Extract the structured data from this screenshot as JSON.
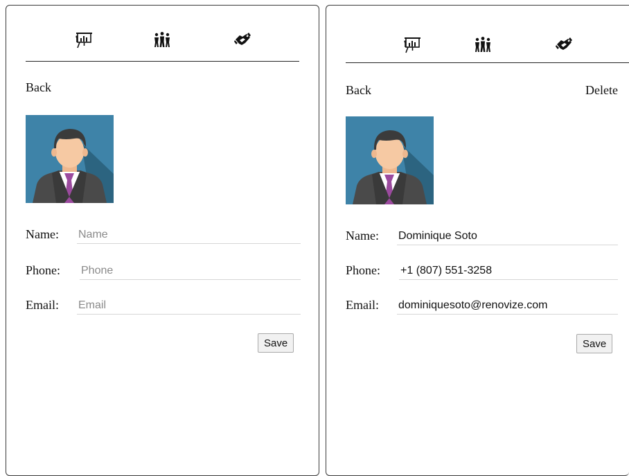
{
  "nav": {
    "icons": [
      "presentation-chart-icon",
      "team-group-icon",
      "handshake-icon"
    ]
  },
  "left_form": {
    "back_label": "Back",
    "fields": [
      {
        "label": "Name:",
        "value": "",
        "placeholder": "Name"
      },
      {
        "label": "Phone:",
        "value": "",
        "placeholder": "Phone"
      },
      {
        "label": "Email:",
        "value": "",
        "placeholder": "Email"
      }
    ],
    "save_label": "Save"
  },
  "right_form": {
    "back_label": "Back",
    "delete_label": "Delete",
    "fields": [
      {
        "label": "Name:",
        "value": "Dominique Soto"
      },
      {
        "label": "Phone:",
        "value": "+1 (807) 551-3258"
      },
      {
        "label": "Email:",
        "value": "dominiquesoto@renovize.com"
      }
    ],
    "save_label": "Save"
  },
  "colors": {
    "avatar_bg": "#3e83a8",
    "avatar_shadow": "#2c6480",
    "skin": "#f6c9a3",
    "hair": "#3b3b3b",
    "suit": "#4a4a4a",
    "tie": "#9b4a9e"
  }
}
